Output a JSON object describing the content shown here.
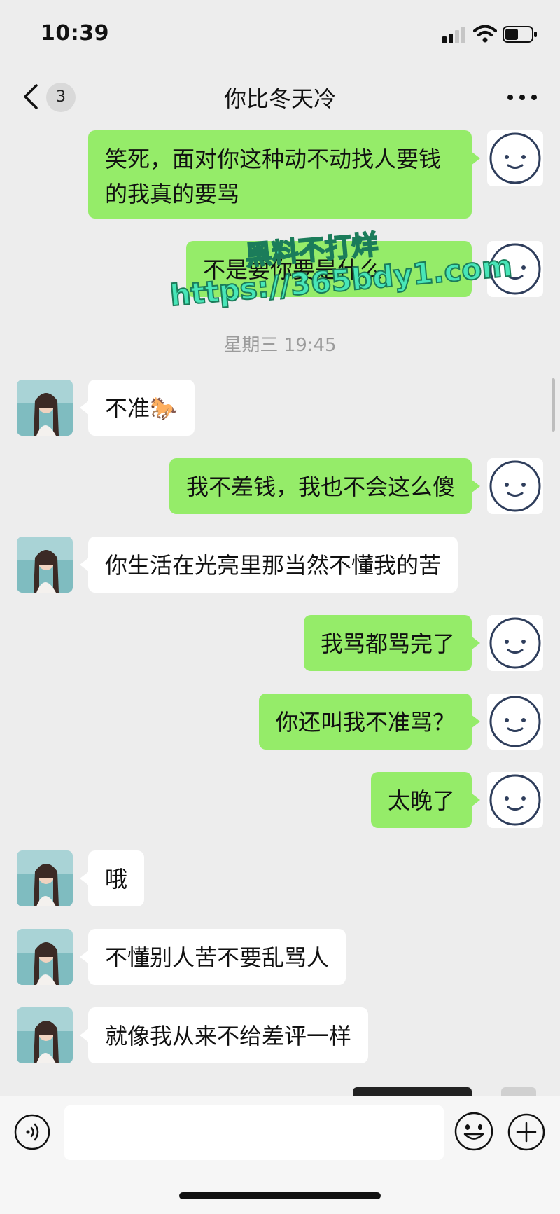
{
  "status_bar": {
    "time": "10:39",
    "battery_level": 0.5
  },
  "header": {
    "back_count": "3",
    "title": "你比冬天冷"
  },
  "timestamp": "星期三 19:45",
  "messages": [
    {
      "sender": "me",
      "text": "笑死，面对你这种动不动找人要钱的我真的要骂"
    },
    {
      "sender": "me",
      "text": "不是要你要是什么"
    },
    {
      "sender": "other",
      "text": "不准🐎"
    },
    {
      "sender": "me",
      "text": "我不差钱，我也不会这么傻"
    },
    {
      "sender": "other",
      "text": "你生活在光亮里那当然不懂我的苦"
    },
    {
      "sender": "me",
      "text": "我骂都骂完了"
    },
    {
      "sender": "me",
      "text": "你还叫我不准骂？"
    },
    {
      "sender": "me",
      "text": "太晚了"
    },
    {
      "sender": "other",
      "text": "哦"
    },
    {
      "sender": "other",
      "text": "不懂别人苦不要乱骂人"
    },
    {
      "sender": "other",
      "text": "就像我从来不给差评一样"
    }
  ],
  "watermark": {
    "line1": "黑料不打烊",
    "line2": "https://365bdy1.com"
  },
  "colors": {
    "my_bubble": "#95ec69",
    "their_bubble": "#ffffff",
    "background": "#ededed"
  },
  "icons": {
    "back": "chevron-left-icon",
    "more": "more-dots-icon",
    "voice": "voice-input-icon",
    "emoji": "emoji-icon",
    "plus": "plus-icon"
  }
}
